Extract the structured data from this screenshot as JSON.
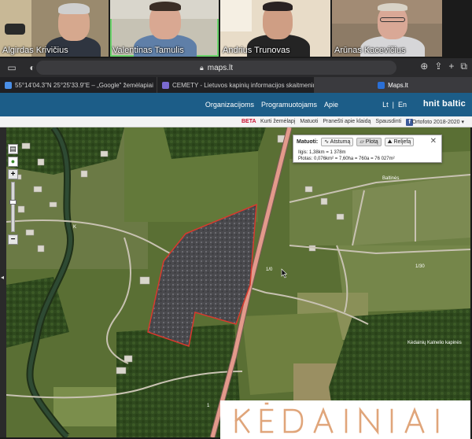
{
  "participants": [
    {
      "name": "Algirdas Krivičius",
      "active": false
    },
    {
      "name": "Valentinas Tamulis",
      "active": true
    },
    {
      "name": "Andrius Trunovas",
      "active": false
    },
    {
      "name": "Arūnas Kacevičius",
      "active": false
    }
  ],
  "browser": {
    "url": "maps.lt",
    "tabs": [
      {
        "label": "55°14'04.3\"N 25°25'33.9\"E – „Google\" žemėlapiai",
        "favicon_color": "#4a8fe7",
        "active": false
      },
      {
        "label": "CEMETY - Lietuvos kapinių informacijos skaitmeninimo...",
        "favicon_color": "#7a6ad0",
        "active": false
      },
      {
        "label": "Maps.lt",
        "favicon_color": "#2a6fd6",
        "active": true
      }
    ]
  },
  "site": {
    "nav": [
      "Organizacijoms",
      "Programuotojams",
      "Apie"
    ],
    "lang": [
      "Lt",
      "En"
    ],
    "brand": "hnit baltic",
    "beta": "BETA",
    "links": [
      "Kurti žemėlapį",
      "Matuoti",
      "Pranešti apie klaidą",
      "Spausdinti"
    ],
    "ortho": "Ortofoto 2018-2020"
  },
  "measure": {
    "label": "Matuoti:",
    "buttons": [
      "Atstumą",
      "Plotą",
      "Reljefą"
    ],
    "length_line": "Ilgis: 1,38km = 1 378m",
    "area_line": "Plotas: 0,076km² = 7,60ha = 760a = 76 027m²"
  },
  "map_labels": [
    "1/0",
    "K",
    "1/30",
    "1",
    "Baltinės",
    "Kėdainių Kalnelio kapinės"
  ],
  "watermark": "KĖDAINIAI",
  "colors": {
    "header": "#1c5d88",
    "measure_outline": "#d83a2e",
    "road": "#e39a8b",
    "active_speaker": "#6bd36b"
  }
}
